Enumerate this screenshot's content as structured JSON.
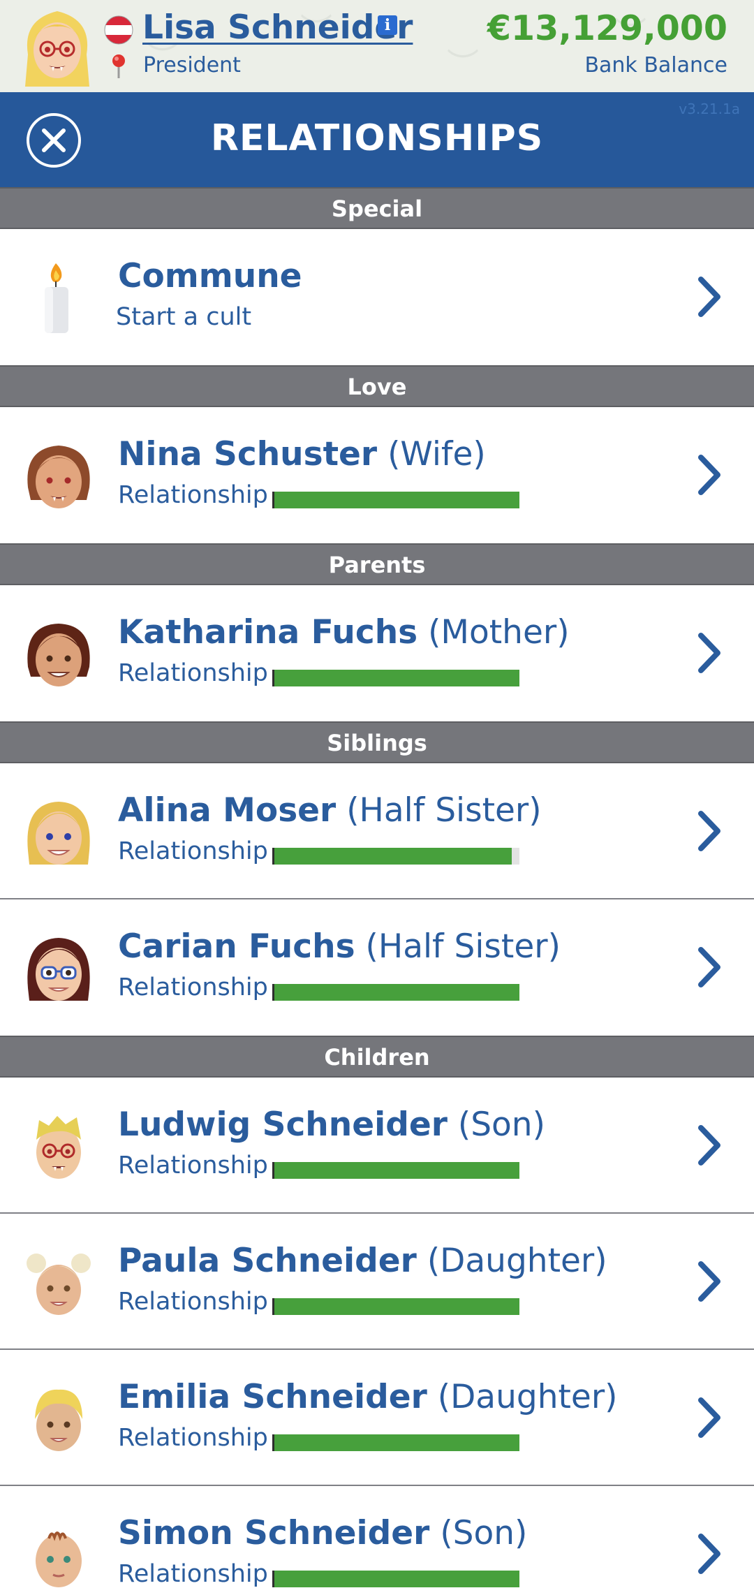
{
  "profile": {
    "name": "Lisa Schneider",
    "job": "President",
    "bank_amount": "€13,129,000",
    "bank_label": "Bank Balance"
  },
  "title_bar": {
    "title": "RELATIONSHIPS",
    "version": "v3.21.1a"
  },
  "sections": [
    {
      "id": "special",
      "title": "Special"
    },
    {
      "id": "love",
      "title": "Love"
    },
    {
      "id": "parents",
      "title": "Parents"
    },
    {
      "id": "siblings",
      "title": "Siblings"
    },
    {
      "id": "children",
      "title": "Children"
    }
  ],
  "rows": [
    {
      "name": "Commune",
      "subtitle": "Start a cult",
      "icon": "candle-icon"
    },
    {
      "name": "Nina Schuster",
      "relation": "(Wife)",
      "relationship_label": "Relationship",
      "relationship_level": 1.0,
      "icon": "wife-avatar-icon"
    },
    {
      "name": "Katharina Fuchs",
      "relation": "(Mother)",
      "relationship_label": "Relationship",
      "relationship_level": 1.0,
      "icon": "mother-avatar-icon"
    },
    {
      "name": "Alina Moser",
      "relation": "(Half Sister)",
      "relationship_label": "Relationship",
      "relationship_level": 0.97,
      "icon": "sister-avatar-icon"
    },
    {
      "name": "Carian Fuchs",
      "relation": "(Half Sister)",
      "relationship_label": "Relationship",
      "relationship_level": 1.0,
      "icon": "sister-glasses-avatar-icon"
    },
    {
      "name": "Ludwig Schneider",
      "relation": "(Son)",
      "relationship_label": "Relationship",
      "relationship_level": 1.0,
      "icon": "son-avatar-icon"
    },
    {
      "name": "Paula Schneider",
      "relation": "(Daughter)",
      "relationship_label": "Relationship",
      "relationship_level": 1.0,
      "icon": "daughter-avatar-icon"
    },
    {
      "name": "Emilia Schneider",
      "relation": "(Daughter)",
      "relationship_label": "Relationship",
      "relationship_level": 1.0,
      "icon": "daughter-blonde-avatar-icon"
    },
    {
      "name": "Simon Schneider",
      "relation": "(Son)",
      "relationship_label": "Relationship",
      "relationship_level": 1.0,
      "icon": "baby-son-avatar-icon"
    }
  ],
  "colors": {
    "brand_blue": "#26589a",
    "text_blue": "#2a5c9d",
    "money_green": "#45a035",
    "bar_green": "#47a03c",
    "section_gray": "#75767b"
  }
}
